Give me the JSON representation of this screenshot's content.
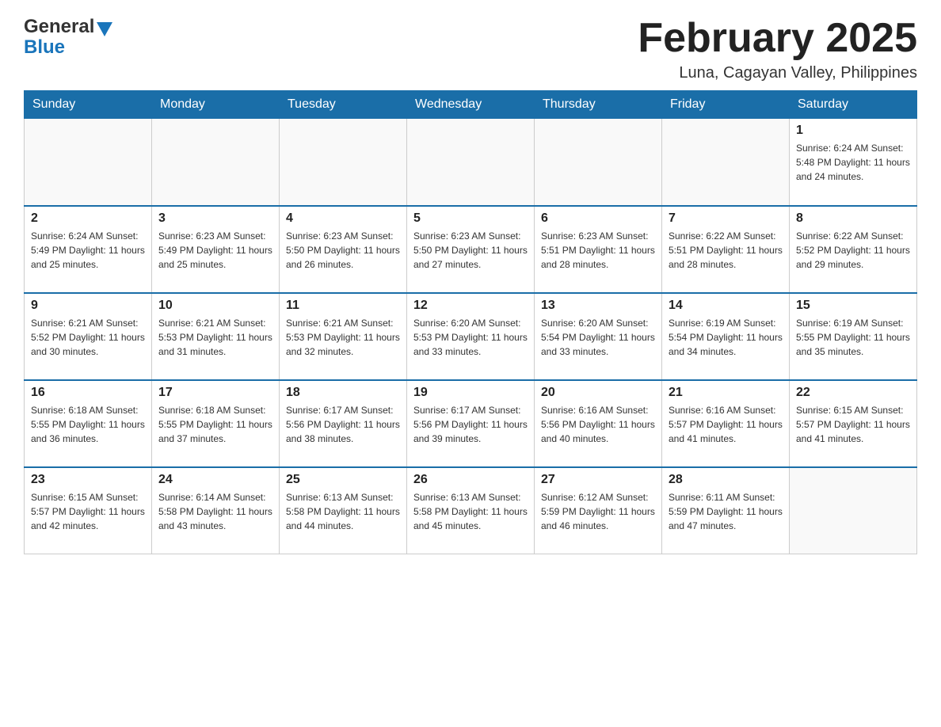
{
  "header": {
    "logo": {
      "general": "General",
      "blue": "Blue"
    },
    "title": "February 2025",
    "subtitle": "Luna, Cagayan Valley, Philippines"
  },
  "days_of_week": [
    "Sunday",
    "Monday",
    "Tuesday",
    "Wednesday",
    "Thursday",
    "Friday",
    "Saturday"
  ],
  "weeks": [
    {
      "days": [
        {
          "number": "",
          "info": ""
        },
        {
          "number": "",
          "info": ""
        },
        {
          "number": "",
          "info": ""
        },
        {
          "number": "",
          "info": ""
        },
        {
          "number": "",
          "info": ""
        },
        {
          "number": "",
          "info": ""
        },
        {
          "number": "1",
          "info": "Sunrise: 6:24 AM\nSunset: 5:48 PM\nDaylight: 11 hours\nand 24 minutes."
        }
      ]
    },
    {
      "days": [
        {
          "number": "2",
          "info": "Sunrise: 6:24 AM\nSunset: 5:49 PM\nDaylight: 11 hours\nand 25 minutes."
        },
        {
          "number": "3",
          "info": "Sunrise: 6:23 AM\nSunset: 5:49 PM\nDaylight: 11 hours\nand 25 minutes."
        },
        {
          "number": "4",
          "info": "Sunrise: 6:23 AM\nSunset: 5:50 PM\nDaylight: 11 hours\nand 26 minutes."
        },
        {
          "number": "5",
          "info": "Sunrise: 6:23 AM\nSunset: 5:50 PM\nDaylight: 11 hours\nand 27 minutes."
        },
        {
          "number": "6",
          "info": "Sunrise: 6:23 AM\nSunset: 5:51 PM\nDaylight: 11 hours\nand 28 minutes."
        },
        {
          "number": "7",
          "info": "Sunrise: 6:22 AM\nSunset: 5:51 PM\nDaylight: 11 hours\nand 28 minutes."
        },
        {
          "number": "8",
          "info": "Sunrise: 6:22 AM\nSunset: 5:52 PM\nDaylight: 11 hours\nand 29 minutes."
        }
      ]
    },
    {
      "days": [
        {
          "number": "9",
          "info": "Sunrise: 6:21 AM\nSunset: 5:52 PM\nDaylight: 11 hours\nand 30 minutes."
        },
        {
          "number": "10",
          "info": "Sunrise: 6:21 AM\nSunset: 5:53 PM\nDaylight: 11 hours\nand 31 minutes."
        },
        {
          "number": "11",
          "info": "Sunrise: 6:21 AM\nSunset: 5:53 PM\nDaylight: 11 hours\nand 32 minutes."
        },
        {
          "number": "12",
          "info": "Sunrise: 6:20 AM\nSunset: 5:53 PM\nDaylight: 11 hours\nand 33 minutes."
        },
        {
          "number": "13",
          "info": "Sunrise: 6:20 AM\nSunset: 5:54 PM\nDaylight: 11 hours\nand 33 minutes."
        },
        {
          "number": "14",
          "info": "Sunrise: 6:19 AM\nSunset: 5:54 PM\nDaylight: 11 hours\nand 34 minutes."
        },
        {
          "number": "15",
          "info": "Sunrise: 6:19 AM\nSunset: 5:55 PM\nDaylight: 11 hours\nand 35 minutes."
        }
      ]
    },
    {
      "days": [
        {
          "number": "16",
          "info": "Sunrise: 6:18 AM\nSunset: 5:55 PM\nDaylight: 11 hours\nand 36 minutes."
        },
        {
          "number": "17",
          "info": "Sunrise: 6:18 AM\nSunset: 5:55 PM\nDaylight: 11 hours\nand 37 minutes."
        },
        {
          "number": "18",
          "info": "Sunrise: 6:17 AM\nSunset: 5:56 PM\nDaylight: 11 hours\nand 38 minutes."
        },
        {
          "number": "19",
          "info": "Sunrise: 6:17 AM\nSunset: 5:56 PM\nDaylight: 11 hours\nand 39 minutes."
        },
        {
          "number": "20",
          "info": "Sunrise: 6:16 AM\nSunset: 5:56 PM\nDaylight: 11 hours\nand 40 minutes."
        },
        {
          "number": "21",
          "info": "Sunrise: 6:16 AM\nSunset: 5:57 PM\nDaylight: 11 hours\nand 41 minutes."
        },
        {
          "number": "22",
          "info": "Sunrise: 6:15 AM\nSunset: 5:57 PM\nDaylight: 11 hours\nand 41 minutes."
        }
      ]
    },
    {
      "days": [
        {
          "number": "23",
          "info": "Sunrise: 6:15 AM\nSunset: 5:57 PM\nDaylight: 11 hours\nand 42 minutes."
        },
        {
          "number": "24",
          "info": "Sunrise: 6:14 AM\nSunset: 5:58 PM\nDaylight: 11 hours\nand 43 minutes."
        },
        {
          "number": "25",
          "info": "Sunrise: 6:13 AM\nSunset: 5:58 PM\nDaylight: 11 hours\nand 44 minutes."
        },
        {
          "number": "26",
          "info": "Sunrise: 6:13 AM\nSunset: 5:58 PM\nDaylight: 11 hours\nand 45 minutes."
        },
        {
          "number": "27",
          "info": "Sunrise: 6:12 AM\nSunset: 5:59 PM\nDaylight: 11 hours\nand 46 minutes."
        },
        {
          "number": "28",
          "info": "Sunrise: 6:11 AM\nSunset: 5:59 PM\nDaylight: 11 hours\nand 47 minutes."
        },
        {
          "number": "",
          "info": ""
        }
      ]
    }
  ]
}
